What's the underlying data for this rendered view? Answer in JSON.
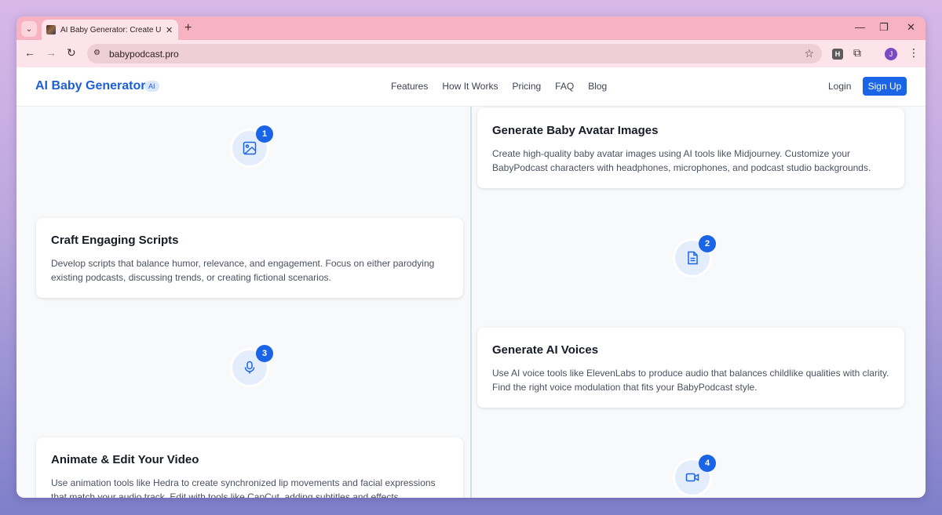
{
  "browser": {
    "tab_title": "AI Baby Generator: Create Uniq",
    "url": "babypodcast.pro",
    "profile_initial": "J",
    "extension_label": "H"
  },
  "site": {
    "brand": "AI Baby Generator",
    "brand_badge": "AI",
    "nav": [
      "Features",
      "How It Works",
      "Pricing",
      "FAQ",
      "Blog"
    ],
    "login": "Login",
    "signup": "Sign Up",
    "accent_color": "#1a64e8"
  },
  "steps": [
    {
      "number": "1",
      "icon": "image-icon",
      "title": "Generate Baby Avatar Images",
      "description": "Create high-quality baby avatar images using AI tools like Midjourney. Customize your BabyPodcast characters with headphones, microphones, and podcast studio backgrounds."
    },
    {
      "number": "2",
      "icon": "document-icon",
      "title": "Craft Engaging Scripts",
      "description": "Develop scripts that balance humor, relevance, and engagement. Focus on either parodying existing podcasts, discussing trends, or creating fictional scenarios."
    },
    {
      "number": "3",
      "icon": "microphone-icon",
      "title": "Generate AI Voices",
      "description": "Use AI voice tools like ElevenLabs to produce audio that balances childlike qualities with clarity. Find the right voice modulation that fits your BabyPodcast style."
    },
    {
      "number": "4",
      "icon": "video-icon",
      "title": "Animate & Edit Your Video",
      "description": "Use animation tools like Hedra to create synchronized lip movements and facial expressions that match your audio track. Edit with tools like CapCut, adding subtitles and effects."
    }
  ]
}
